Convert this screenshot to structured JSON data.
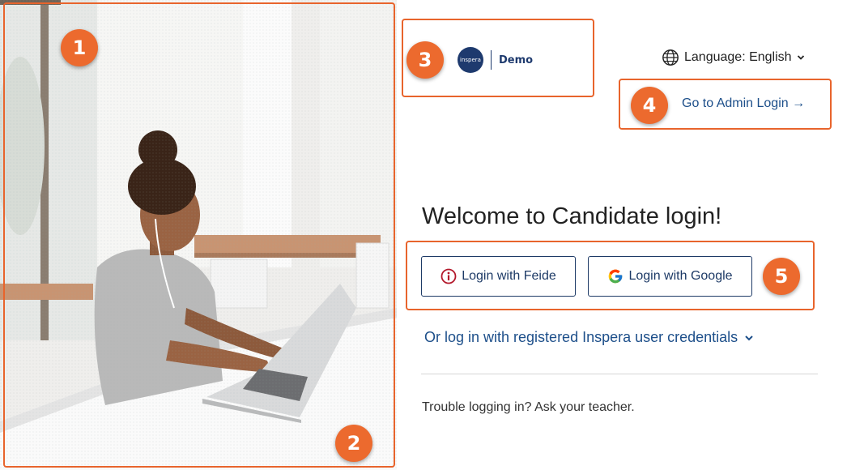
{
  "branding": {
    "logo_text": "inspera",
    "product_label": "Demo"
  },
  "header": {
    "language_label": "Language: English",
    "admin_login_label": "Go to Admin Login →"
  },
  "main": {
    "title": "Welcome to Candidate login!",
    "feide_button_label": "Login with Feide",
    "google_button_label": "Login with Google",
    "credentials_toggle_label": "Or log in with registered Inspera user credentials",
    "trouble_text": "Trouble logging in? Ask your teacher."
  },
  "annotations": {
    "badge_1": "1",
    "badge_2": "2",
    "badge_3": "3",
    "badge_4": "4",
    "badge_5": "5",
    "color": "#ec6a2e"
  },
  "colors": {
    "brand_navy": "#1e3a6e",
    "link_blue": "#1d4f8a",
    "feide_red": "#b3182b"
  },
  "icons": {
    "language": "globe-icon",
    "language_dropdown": "chevron-down-icon",
    "feide": "feide-icon",
    "google": "google-g-icon",
    "credentials_expand": "chevron-down-icon"
  }
}
